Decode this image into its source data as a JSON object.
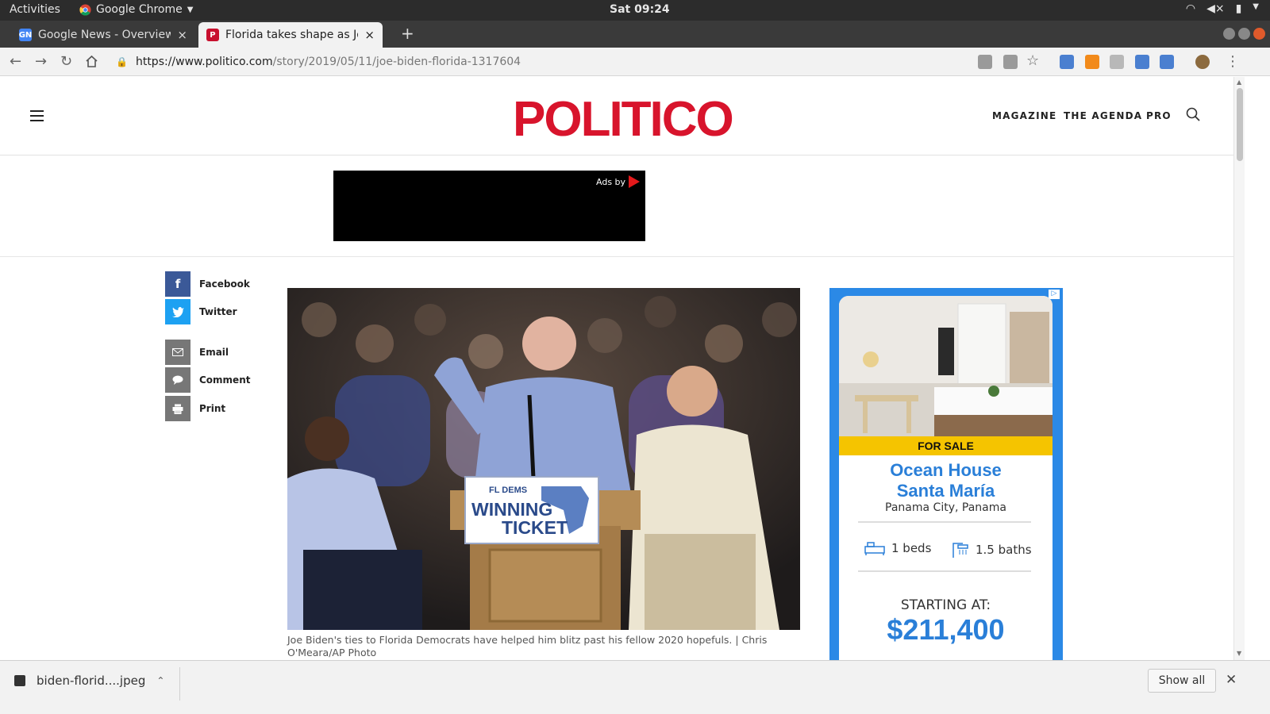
{
  "system": {
    "activities": "Activities",
    "app_name": "Google Chrome",
    "clock": "Sat 09:24"
  },
  "tabs": [
    {
      "title": "Google News - Overview",
      "favicon": "google-news-icon",
      "active": false
    },
    {
      "title": "Florida takes shape as Joe",
      "favicon": "politico-icon",
      "active": true
    }
  ],
  "toolbar": {
    "url_host": "https://www.politico.com",
    "url_path": "/story/2019/05/11/joe-biden-florida-1317604"
  },
  "site": {
    "logo": "POLITICO",
    "nav": [
      "MAGAZINE",
      "THE AGENDA",
      "PRO"
    ]
  },
  "top_ad": {
    "ads_by": "Ads by"
  },
  "share": [
    {
      "label": "Facebook",
      "icon": "facebook-icon",
      "color": "#3b5998"
    },
    {
      "label": "Twitter",
      "icon": "twitter-icon",
      "color": "#1da1f2"
    },
    {
      "label": "Email",
      "icon": "email-icon",
      "color": "#777777"
    },
    {
      "label": "Comment",
      "icon": "comment-icon",
      "color": "#777777"
    },
    {
      "label": "Print",
      "icon": "print-icon",
      "color": "#777777"
    }
  ],
  "article": {
    "caption": "Joe Biden's ties to Florida Democrats have helped him blitz past his fellow 2020 hopefuls. | Chris O'Meara/AP Photo",
    "podium_sign": {
      "line1": "FL DEMS",
      "line2": "WINNING",
      "line3": "TICKET"
    }
  },
  "side_ad": {
    "badge": "FOR SALE",
    "title_line1": "Ocean House",
    "title_line2": "Santa María",
    "location": "Panama City, Panama",
    "beds": "1 beds",
    "baths": "1.5 baths",
    "starting_label": "STARTING AT:",
    "price": "$211,400",
    "accent": "#2b89e6",
    "badge_color": "#f5c400"
  },
  "downloads": {
    "file": "biden-florid....jpeg",
    "show_all": "Show all"
  }
}
